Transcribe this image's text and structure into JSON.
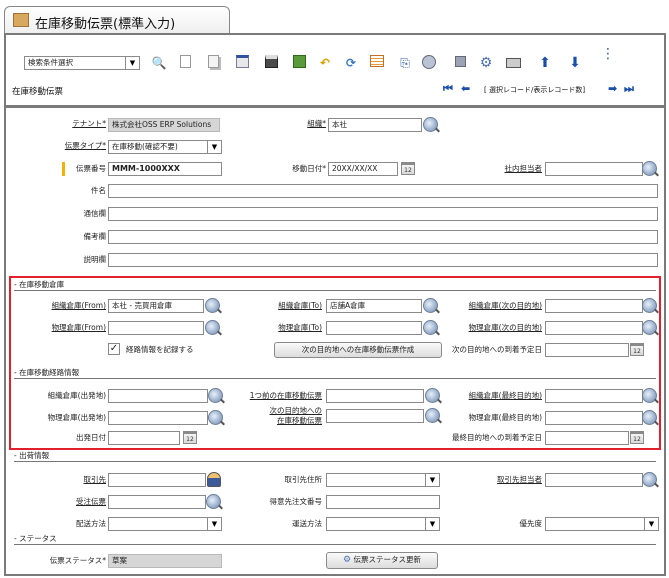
{
  "window": {
    "title": "在庫移動伝票(標準入力)"
  },
  "toolbar": {
    "search_select": "検索条件選択",
    "screen_title": "在庫移動伝票",
    "record_counter": "[ 選択レコード/表示レコード数]",
    "icons": [
      "search-icon",
      "new-icon",
      "copy-icon",
      "register-icon",
      "save-icon",
      "delete-icon",
      "undo-icon",
      "refresh-icon",
      "list-icon",
      "attach-icon",
      "zoom-icon",
      "print-preview-icon",
      "settings-icon",
      "print-icon",
      "up-arrow-icon",
      "down-arrow-icon",
      "more-icon"
    ]
  },
  "header": {
    "tenant_label": "テナント*",
    "tenant_value": "株式会社OSS ERP Solutions",
    "org_label": "組織*",
    "org_value": "本社",
    "doctype_label": "伝票タイプ*",
    "doctype_value": "在庫移動(確認不要)",
    "docno_label": "伝票番号",
    "docno_value": "MMM-1000XXX",
    "movedate_label": "移動日付*",
    "movedate_value": "20XX/XX/XX",
    "staff_label": "社内担当者",
    "subject_label": "件名",
    "comm_label": "通信欄",
    "remark_label": "備考欄",
    "desc_label": "説明欄"
  },
  "warehouse": {
    "section_title": "- 在庫移動倉庫",
    "org_wh_from_label": "組織倉庫(From)",
    "org_wh_from_value": "本社 - 売買用倉庫",
    "org_wh_to_label": "組織倉庫(To)",
    "org_wh_to_value": "店舗A倉庫",
    "org_wh_next_label": "組織倉庫(次の目的地)",
    "phys_wh_from_label": "物理倉庫(From)",
    "phys_wh_to_label": "物理倉庫(To)",
    "phys_wh_next_label": "物理倉庫(次の目的地)",
    "record_route_label": "経路情報を記録する",
    "create_next_button": "次の目的地への在庫移動伝票作成",
    "next_arrival_label": "次の目的地への到着予定日"
  },
  "route": {
    "section_title": "- 在庫移動経路情報",
    "org_wh_depart_label": "組織倉庫(出発地)",
    "prev_doc_label": "1つ前の在庫移動伝票",
    "org_wh_final_label": "組織倉庫(最終目的地)",
    "phys_wh_depart_label": "物理倉庫(出発地)",
    "next_doc_label_1": "次の目的地への",
    "next_doc_label_2": "在庫移動伝票",
    "phys_wh_final_label": "物理倉庫(最終目的地)",
    "depart_date_label": "出発日付",
    "final_arrival_label": "最終目的地への到着予定日"
  },
  "shipping": {
    "section_title": "- 出荷情報",
    "partner_label": "取引先",
    "partner_site_label": "取引先住所",
    "partner_staff_label": "取引先担当者",
    "order_label": "受注伝票",
    "customer_docno_label": "得意先注文番号",
    "delivery_method_label": "配送方法",
    "carrier_label": "運送方法",
    "priority_label": "優先度"
  },
  "status": {
    "section_title": "- ステータス",
    "doc_status_label": "伝票ステータス*",
    "doc_status_value": "草案",
    "update_button": "伝票ステータス更新"
  },
  "colors": {
    "highlight_border": "#e0202a",
    "docno_marker": "#f0b400",
    "toolbar_blue": "#1a4fa8"
  }
}
